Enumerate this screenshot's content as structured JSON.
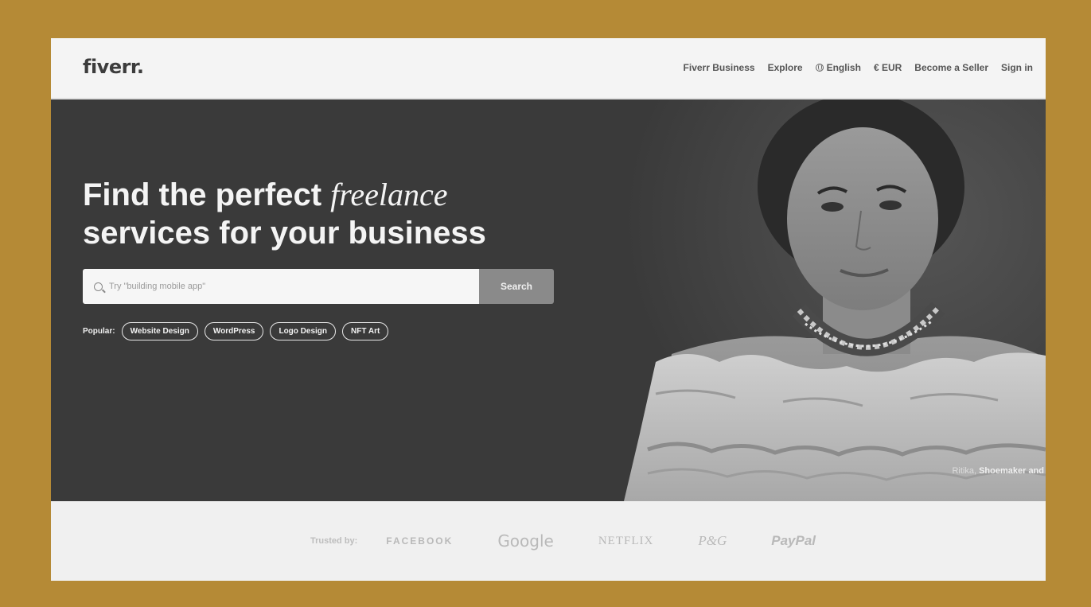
{
  "header": {
    "logo": "fiverr.",
    "nav": {
      "business": "Fiverr Business",
      "explore": "Explore",
      "language": "English",
      "currency": "€ EUR",
      "become_seller": "Become a Seller",
      "sign_in": "Sign in"
    }
  },
  "hero": {
    "headline_line1_start": "Find the perfect ",
    "headline_line1_italic": "freelance",
    "headline_line2": "services for your business",
    "search": {
      "placeholder": "Try \"building mobile app\"",
      "button": "Search"
    },
    "popular": {
      "label": "Popular:",
      "chips": [
        "Website Design",
        "WordPress",
        "Logo Design",
        "NFT Art"
      ]
    },
    "caption": {
      "name": "Ritika,",
      "role": "Shoemaker and"
    }
  },
  "trusted": {
    "label": "Trusted by:",
    "brands": [
      "FACEBOOK",
      "Google",
      "NETFLIX",
      "P&G",
      "PayPal"
    ]
  },
  "icons": {
    "language": "globe-icon",
    "search": "search-icon"
  }
}
